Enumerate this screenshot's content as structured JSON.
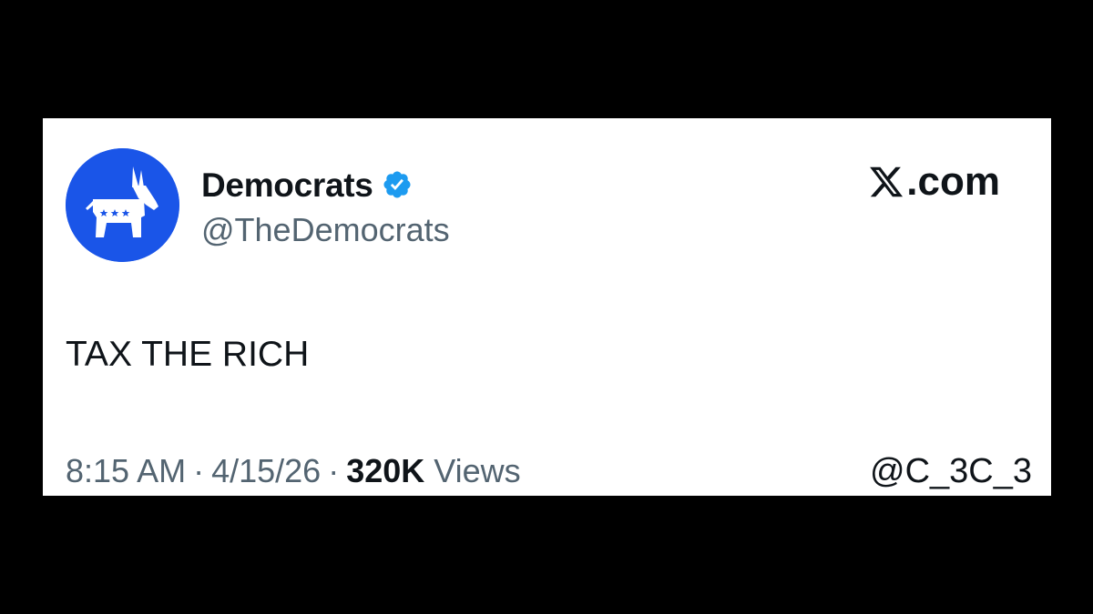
{
  "author": {
    "display_name": "Democrats",
    "handle": "@TheDemocrats",
    "verified": true,
    "avatar_icon": "donkey-logo-icon",
    "avatar_color": "#1a55e8",
    "verified_color": "#1d9bf0"
  },
  "site": {
    "label": ".com",
    "logo_icon": "x-logo-icon"
  },
  "post": {
    "text": "TAX THE RICH"
  },
  "meta": {
    "time": "8:15 AM",
    "separator": "·",
    "date": "4/15/26",
    "views_count": "320K",
    "views_label": "Views"
  },
  "watermark": "@C_3C_3"
}
